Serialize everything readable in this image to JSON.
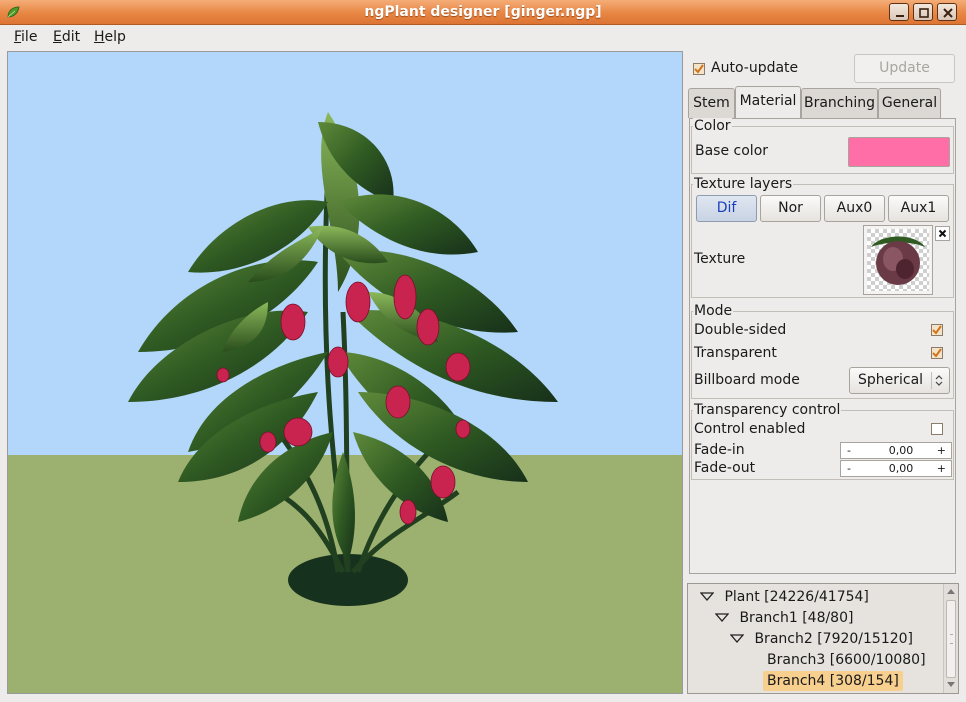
{
  "window": {
    "title": "ngPlant designer [ginger.ngp]",
    "controls": [
      "minimize-icon",
      "maximize-icon",
      "close-icon"
    ]
  },
  "menu": {
    "items": [
      {
        "label": "File",
        "mnemonic": "F",
        "rest": "ile"
      },
      {
        "label": "Edit",
        "mnemonic": "E",
        "rest": "dit"
      },
      {
        "label": "Help",
        "mnemonic": "H",
        "rest": "elp"
      }
    ]
  },
  "viewport": {
    "sky_color": "#b2d7fa",
    "ground_color": "#9cb070",
    "leaf_color": "#2f5a22",
    "flower_color": "#c8244f"
  },
  "panel": {
    "auto_update_label": "Auto-update",
    "auto_update_checked": true,
    "update_button": "Update",
    "tabs": [
      "Stem",
      "Material",
      "Branching",
      "General"
    ],
    "active_tab": "Material",
    "color_group": {
      "title": "Color",
      "base_color_label": "Base color",
      "base_color": "#ff6ea7"
    },
    "texture_group": {
      "title": "Texture layers",
      "layers": [
        "Dif",
        "Nor",
        "Aux0",
        "Aux1"
      ],
      "active_layer": "Dif",
      "texture_label": "Texture",
      "clear_icon": "close-icon"
    },
    "mode_group": {
      "title": "Mode",
      "double_sided_label": "Double-sided",
      "double_sided": true,
      "transparent_label": "Transparent",
      "transparent": true,
      "billboard_label": "Billboard mode",
      "billboard_value": "Spherical"
    },
    "transparency_group": {
      "title": "Transparency control",
      "control_enabled_label": "Control enabled",
      "control_enabled": false,
      "fade_in_label": "Fade-in",
      "fade_in_value": "0,00",
      "fade_out_label": "Fade-out",
      "fade_out_value": "0,00",
      "minus": "-",
      "plus": "+"
    }
  },
  "tree": {
    "nodes": [
      {
        "label": "Plant [24226/41754]",
        "expanded": true,
        "depth": 0
      },
      {
        "label": "Branch1 [48/80]",
        "expanded": true,
        "depth": 1
      },
      {
        "label": "Branch2 [7920/15120]",
        "expanded": true,
        "depth": 2
      },
      {
        "label": "Branch3 [6600/10080]",
        "expanded": false,
        "depth": 3
      },
      {
        "label": "Branch4 [308/154]",
        "expanded": false,
        "depth": 3,
        "selected": true
      }
    ]
  }
}
